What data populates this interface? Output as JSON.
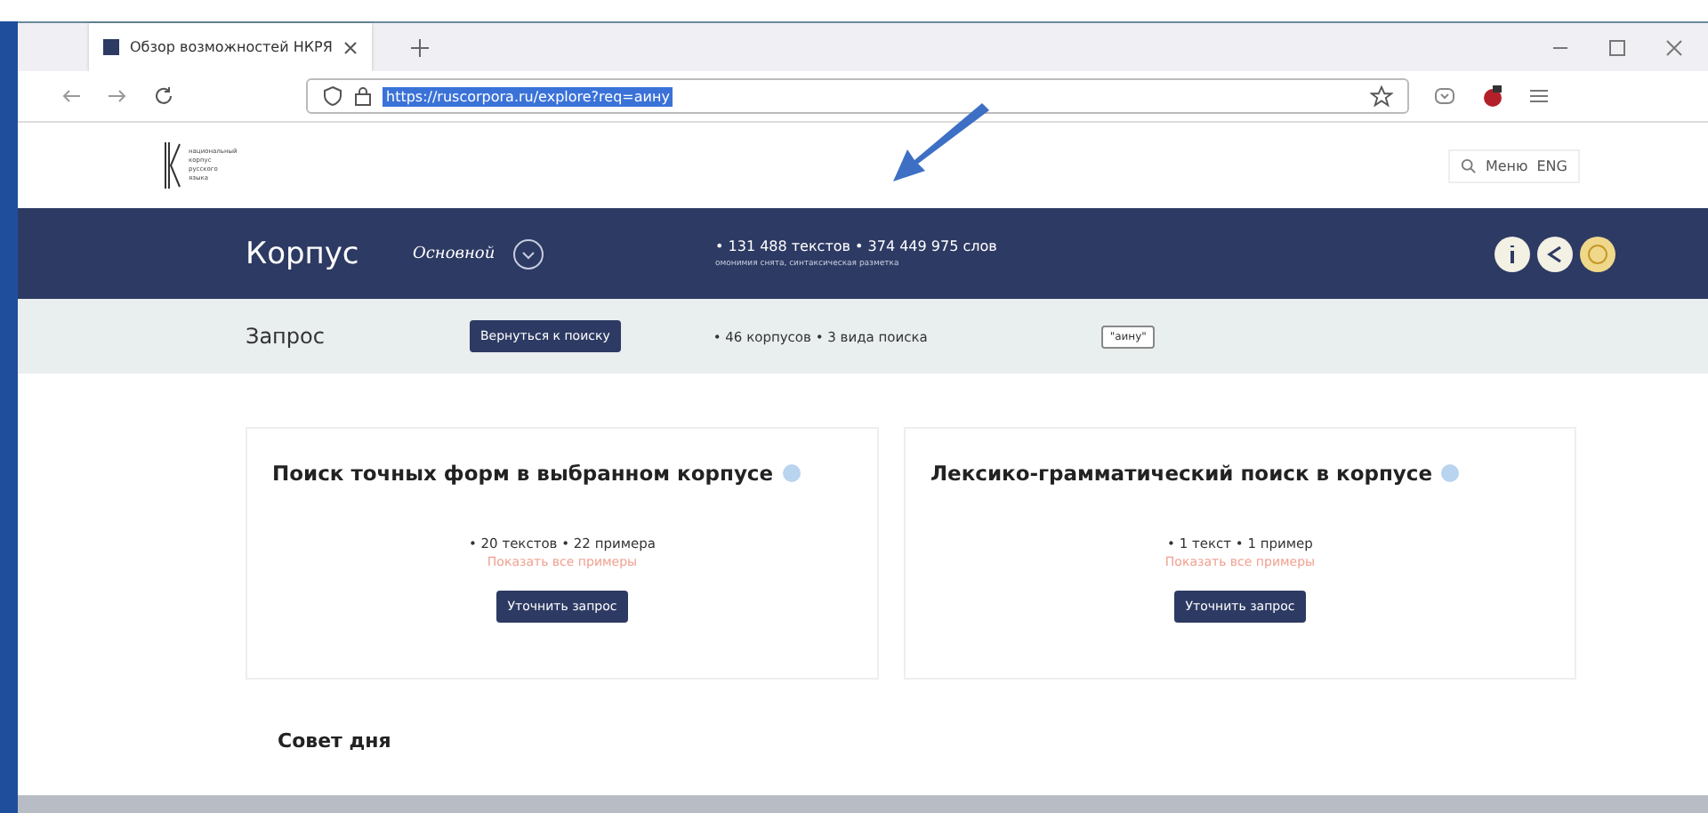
{
  "browser": {
    "tabs": [
      {
        "title": "Обзор возможностей НКРЯ",
        "selected": true
      }
    ],
    "url": "https://ruscorpora.ru/explore?req=аину"
  },
  "header": {
    "logo_lines": [
      "национальный",
      "корпус",
      "русского",
      "языка"
    ],
    "menu": "Меню",
    "language": "ENG"
  },
  "corpus_bar": {
    "title": "Корпус",
    "corpus": "Основной",
    "stats": "• 131 488 текстов • 374 449 975 слов",
    "note": "омонимия снята, синтаксическая разметка"
  },
  "query_bar": {
    "title": "Запрос",
    "back": "Вернуться к поиску",
    "stats": "• 46 корпусов • 3 вида поиска",
    "query": "\"аину\""
  },
  "cards": [
    {
      "title": "Поиск точных форм в выбранном корпусе",
      "stats": "• 20 текстов • 22 примера",
      "link": "Показать все примеры",
      "button": "Уточнить запрос"
    },
    {
      "title": "Лексико-грамматический поиск в корпусе",
      "stats": "• 1 текст • 1 пример",
      "link": "Показать все примеры",
      "button": "Уточнить запрос"
    }
  ],
  "tip_title": "Совет дня"
}
